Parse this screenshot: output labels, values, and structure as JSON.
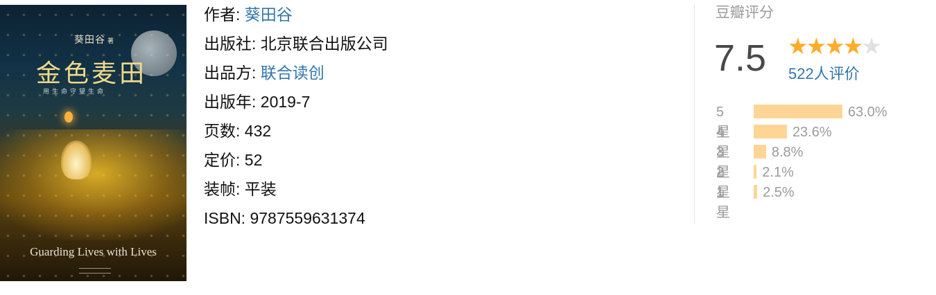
{
  "cover": {
    "author_cn": "葵田谷",
    "author_suffix": "著",
    "title_cn": "金色麦田",
    "subtitle_cn": "用生命守望生命",
    "title_en": "Guarding Lives with Lives"
  },
  "info": {
    "author_label": "作者:",
    "author_value": "葵田谷",
    "publisher_label": "出版社:",
    "publisher_value": "北京联合出版公司",
    "producer_label": "出品方:",
    "producer_value": "联合读创",
    "year_label": "出版年:",
    "year_value": "2019-7",
    "pages_label": "页数:",
    "pages_value": "432",
    "price_label": "定价:",
    "price_value": "52",
    "binding_label": "装帧:",
    "binding_value": "平装",
    "isbn_label": "ISBN:",
    "isbn_value": "9787559631374"
  },
  "rating": {
    "title": "豆瓣评分",
    "score": "7.5",
    "stars_filled": 4,
    "stars_total": 5,
    "count_text": "522人评价",
    "accent_color": "#ffac2d",
    "bar_color": "#ffd596",
    "link_color": "#3377aa",
    "distribution": [
      {
        "label": "5星",
        "percent_text": "63.0%",
        "percent": 63.0
      },
      {
        "label": "4星",
        "percent_text": "23.6%",
        "percent": 23.6
      },
      {
        "label": "3星",
        "percent_text": "8.8%",
        "percent": 8.8
      },
      {
        "label": "2星",
        "percent_text": "2.1%",
        "percent": 2.1
      },
      {
        "label": "1星",
        "percent_text": "2.5%",
        "percent": 2.5
      }
    ]
  }
}
